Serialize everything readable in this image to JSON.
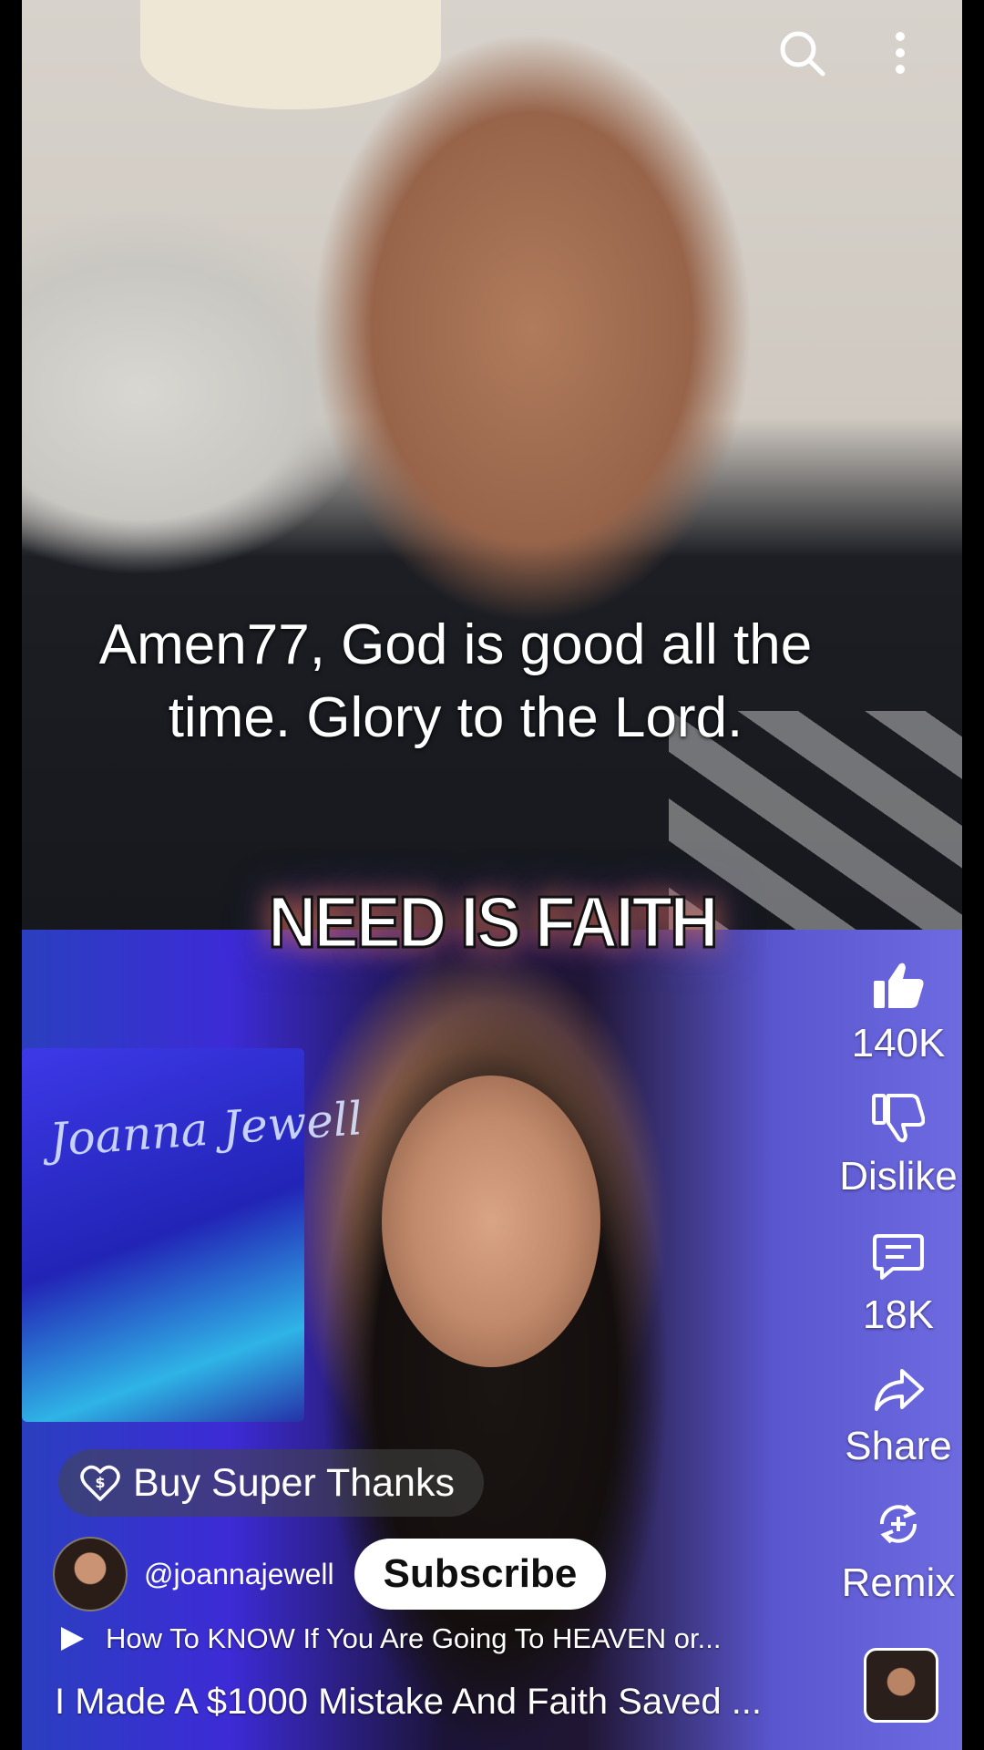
{
  "overlay": {
    "caption_line1": "Amen77, God is good all the",
    "caption_line2": "time. Glory to the Lord.",
    "video_text": "NEED IS FAITH",
    "background_sign_text": "Joanna Jewell"
  },
  "header": {
    "search_icon": "search-icon",
    "menu_icon": "more-vertical-icon"
  },
  "actions": {
    "like_count": "140K",
    "dislike_label": "Dislike",
    "comment_count": "18K",
    "share_label": "Share",
    "remix_label": "Remix"
  },
  "channel": {
    "super_thanks_label": "Buy Super Thanks",
    "handle": "@joannajewell",
    "subscribe_label": "Subscribe"
  },
  "video": {
    "related_video": "How To KNOW If You Are Going To HEAVEN or...",
    "title": "I Made A $1000 Mistake And Faith Saved ..."
  },
  "colors": {
    "text": "#ffffff",
    "subscribe_bg": "#ffffff",
    "subscribe_text": "#0f0f0f"
  }
}
